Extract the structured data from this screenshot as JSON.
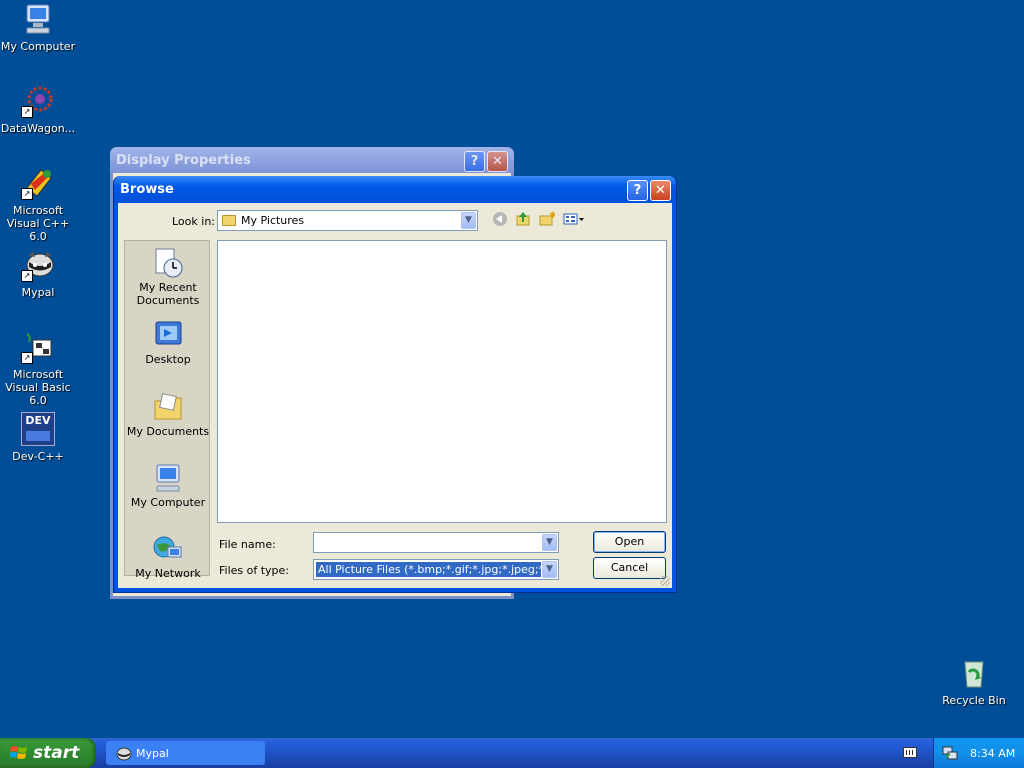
{
  "desktop": {
    "icons": [
      {
        "label": "My Computer"
      },
      {
        "label": "DataWagon..."
      },
      {
        "label": "Microsoft Visual C++ 6.0"
      },
      {
        "label": "Mypal"
      },
      {
        "label": "Microsoft Visual Basic 6.0"
      },
      {
        "label": "Dev-C++"
      },
      {
        "label": "Recycle Bin"
      }
    ],
    "dev_icon_text": "DEV"
  },
  "display_properties": {
    "title": "Display Properties",
    "help_glyph": "?",
    "close_glyph": "✕"
  },
  "browse": {
    "title": "Browse",
    "help_glyph": "?",
    "close_glyph": "✕",
    "look_in_label": "Look in:",
    "look_in_value": "My Pictures",
    "places": [
      {
        "label": "My Recent Documents"
      },
      {
        "label": "Desktop"
      },
      {
        "label": "My Documents"
      },
      {
        "label": "My Computer"
      },
      {
        "label": "My Network"
      }
    ],
    "file_name_label": "File name:",
    "file_name_value": "",
    "files_of_type_label": "Files of type:",
    "files_of_type_value": "All Picture Files (*.bmp;*.gif;*.jpg;*.jpeg;*.dib;*.pn",
    "open_label": "Open",
    "cancel_label": "Cancel"
  },
  "taskbar": {
    "start_label": "start",
    "task_label": "Mypal",
    "clock": "8:34 AM"
  },
  "colors": {
    "desktop": "#004e98",
    "titlebar_active": "#0058e6",
    "dialog_face": "#ece9d8"
  }
}
